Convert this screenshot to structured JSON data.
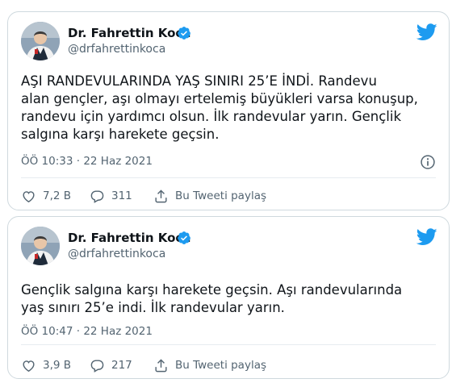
{
  "tweets": [
    {
      "author_name": "Dr. Fahrettin Koca",
      "handle": "@drfahrettinkoca",
      "text_lines": [
        "AŞI RANDEVULARINDA YAŞ SINIRI 25’E İNDİ. Randevu",
        "alan gençler, aşı olmayı ertelemiş büyükleri varsa konuşup,",
        "randevu için yardımcı olsun. İlk randevular yarın. Gençlik",
        "salgına karşı harekete geçsin."
      ],
      "timestamp": "ÖÖ 10:33 · 22 Haz 2021",
      "likes": "7,2 B",
      "replies": "311",
      "share_label": "Bu Tweeti paylaş"
    },
    {
      "author_name": "Dr. Fahrettin Koca",
      "handle": "@drfahrettinkoca",
      "text_lines": [
        "Gençlik salgına karşı harekete geçsin. Aşı randevularında",
        "yaş sınırı 25’e indi. İlk randevular yarın."
      ],
      "timestamp": "ÖÖ 10:47 · 22 Haz 2021",
      "likes": "3,9 B",
      "replies": "217",
      "share_label": "Bu Tweeti paylaş"
    }
  ],
  "icons": {
    "verified": "verified-badge-icon",
    "bird": "twitter-bird-icon",
    "info": "info-icon",
    "like": "heart-icon",
    "reply": "reply-icon",
    "share": "share-icon"
  },
  "colors": {
    "accent": "#1d9bf0",
    "border": "#cfd9de",
    "muted": "#536471"
  }
}
